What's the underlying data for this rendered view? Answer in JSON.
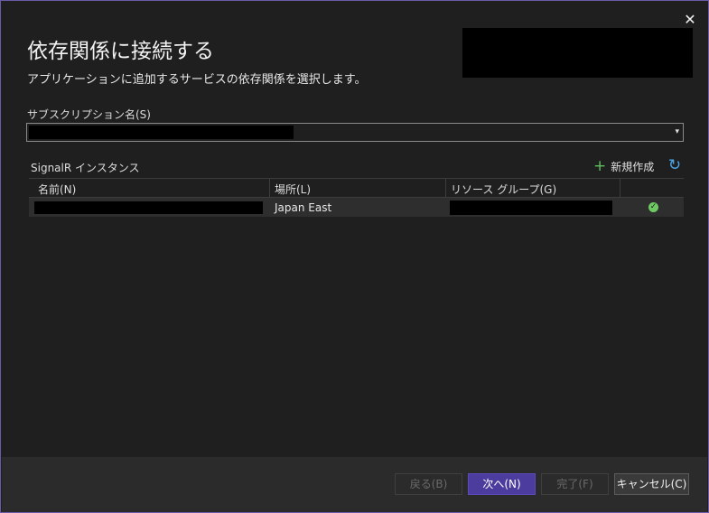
{
  "dialog": {
    "close_glyph": "✕",
    "title": "依存関係に接続する",
    "subtitle": "アプリケーションに追加するサービスの依存関係を選択します。"
  },
  "subscription": {
    "label": "サブスクリプション名(S)",
    "arrow_glyph": "▾"
  },
  "instances": {
    "label": "SignalR インスタンス",
    "new_label": "新規作成",
    "plus_glyph": "+",
    "refresh_glyph": "↻",
    "columns": [
      "名前(N)",
      "場所(L)",
      "リソース グループ(G)"
    ],
    "rows": [
      {
        "location": "Japan East",
        "status_glyph": "✓"
      }
    ]
  },
  "footer": {
    "back_label": "戻る(B)",
    "next_label": "次へ(N)",
    "finish_label": "完了(F)",
    "cancel_label": "キャンセル(C)"
  },
  "colors": {
    "accent": "#4b3c9e",
    "success": "#6ecb63",
    "refresh": "#4ea6e8",
    "add": "#5fbf5f"
  },
  "icons": {
    "close": "close-icon",
    "dropdown": "chevron-down-icon",
    "add": "plus-icon",
    "refresh": "refresh-icon",
    "status": "check-circle-icon"
  }
}
